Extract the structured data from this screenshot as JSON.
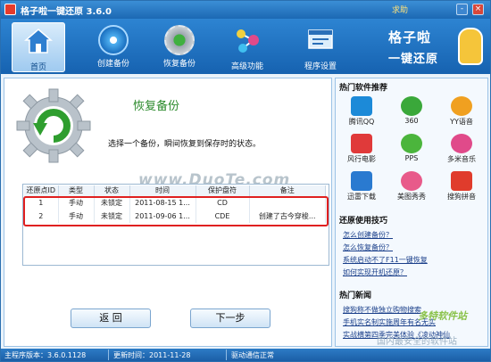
{
  "window": {
    "title": "格子啦一键还原 3.6.0",
    "help": "求助",
    "minimize": "-",
    "close": "×"
  },
  "toolbar": {
    "items": [
      {
        "label": "首页",
        "icon": "home-icon",
        "active": true
      },
      {
        "label": "创建备份",
        "icon": "backup-disc-icon",
        "active": false
      },
      {
        "label": "恢复备份",
        "icon": "restore-gear-icon",
        "active": false
      },
      {
        "label": "高级功能",
        "icon": "molecule-icon",
        "active": false
      },
      {
        "label": "程序设置",
        "icon": "settings-window-icon",
        "active": false
      }
    ],
    "brand_line1": "格子啦",
    "brand_line2": "一键还原"
  },
  "main": {
    "title": "恢复备份",
    "description": "选择一个备份，瞬间恢复到保存时的状态。",
    "watermark": "www.DuoTe.com",
    "columns": [
      "还原点ID",
      "类型",
      "状态",
      "时间",
      "保护盘符",
      "备注"
    ],
    "rows": [
      [
        "1",
        "手动",
        "未锁定",
        "2011-08-15 1...",
        "CD",
        ""
      ],
      [
        "2",
        "手动",
        "未锁定",
        "2011-09-06 1...",
        "CDE",
        "创建了古今穿梭..."
      ]
    ],
    "back_button": "返  回",
    "next_button": "下一步"
  },
  "side": {
    "hot_software_title": "热门软件推荐",
    "apps": [
      {
        "name": "腾讯QQ",
        "color": "#1c8ad8"
      },
      {
        "name": "360",
        "color": "#3aa83a"
      },
      {
        "name": "YY语音",
        "color": "#f0a020"
      },
      {
        "name": "风行电影",
        "color": "#e03a3a"
      },
      {
        "name": "PPS",
        "color": "#4bb53c"
      },
      {
        "name": "多米音乐",
        "color": "#e04a8a"
      },
      {
        "name": "迅雷下载",
        "color": "#2a7ad0"
      },
      {
        "name": "美图秀秀",
        "color": "#e85a8a"
      },
      {
        "name": "搜狗拼音",
        "color": "#e03c2c"
      }
    ],
    "tips_title": "还原使用技巧",
    "tips": [
      "怎么创建备份？",
      "怎么恢复备份？",
      "系统启动不了F11一键恢复",
      "如何实现开机还原？"
    ],
    "news_title": "热门新闻",
    "news": [
      "搜狗称不做独立购物搜索",
      "手机实名制实施周年有名无实",
      "实战横第四季完美体验《凌动神仙"
    ],
    "watermark_a": "多特软件站",
    "watermark_b": "国内最安全的软件站"
  },
  "status": {
    "version": "主程序版本：3.6.0.1128",
    "updated": "更新时间：2011-11-28",
    "driver": "驱动通信正常"
  }
}
